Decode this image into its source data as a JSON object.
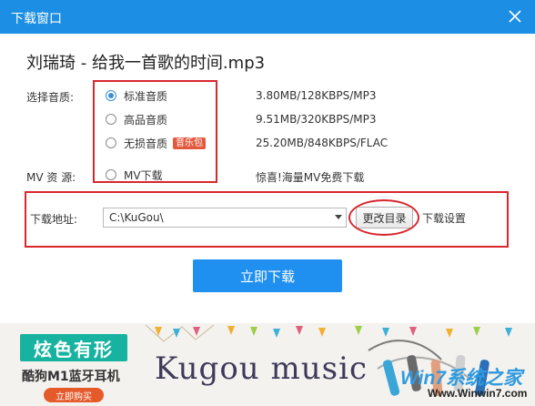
{
  "window": {
    "title": "下载窗口"
  },
  "song": {
    "filename": "刘瑞琦 - 给我一首歌的时间.mp3"
  },
  "quality": {
    "label": "选择音质:",
    "options": [
      {
        "label": "标准音质",
        "info": "3.80MB/128KBPS/MP3",
        "selected": true
      },
      {
        "label": "高品音质",
        "info": "9.51MB/320KBPS/MP3",
        "selected": false
      },
      {
        "label": "无损音质",
        "badge": "音乐包",
        "info": "25.20MB/848KBPS/FLAC",
        "selected": false
      }
    ]
  },
  "mv": {
    "label": "MV 资 源:",
    "option": "MV下载",
    "info": "惊喜!海量MV免费下载"
  },
  "download": {
    "address_label": "下载地址:",
    "path": "C:\\KuGou\\",
    "change_dir": "更改目录",
    "settings": "下载设置",
    "button": "立即下载"
  },
  "banner": {
    "headline": "炫色有形",
    "subline": "酷狗M1蓝牙耳机",
    "buy": "立即购买",
    "brand": "Kugou music",
    "watermark_top": "Win7系统之家",
    "watermark_bottom": "Www.Winwin7.com"
  },
  "colors": {
    "titlebar": "#1c8ee3",
    "primary_button": "#1f8ff0",
    "highlight": "#d9272e",
    "badge": "#e3593d",
    "ad_teal": "#17b3a0"
  }
}
